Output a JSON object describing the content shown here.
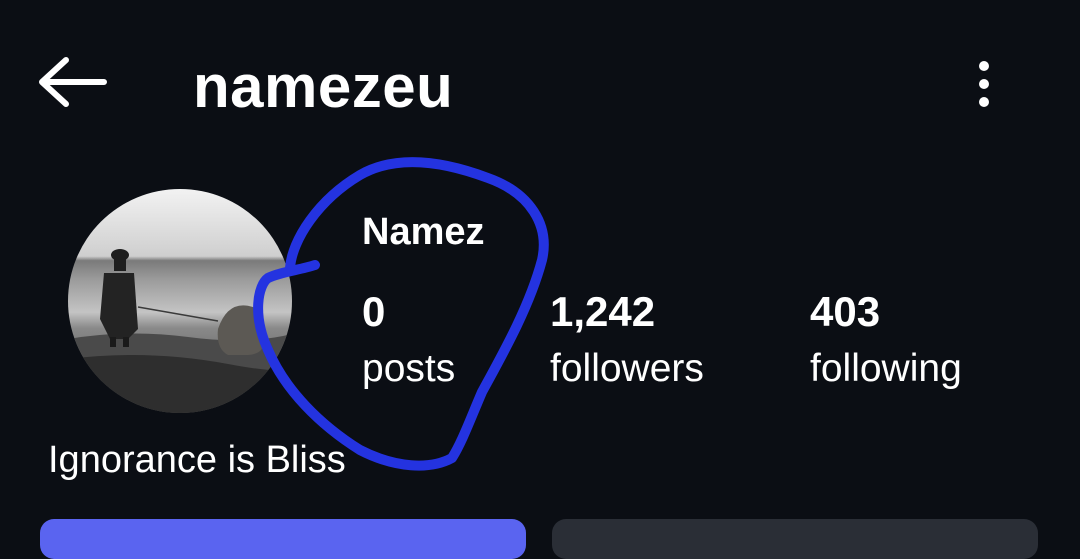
{
  "header": {
    "back_icon": "arrow-left-icon",
    "username": "namezeu",
    "more_icon": "more-vertical-icon"
  },
  "profile": {
    "avatar": "avatar",
    "display_name": "Namez",
    "stats": [
      {
        "value": "0",
        "label": "posts"
      },
      {
        "value": "1,242",
        "label": "followers"
      },
      {
        "value": "403",
        "label": "following"
      }
    ],
    "bio": "Ignorance is Bliss"
  },
  "colors": {
    "background": "#0b0e14",
    "text": "#ffffff",
    "scribble": "#2433e0",
    "primary_button": "#5a64f0",
    "secondary_button": "#2a2e36"
  }
}
